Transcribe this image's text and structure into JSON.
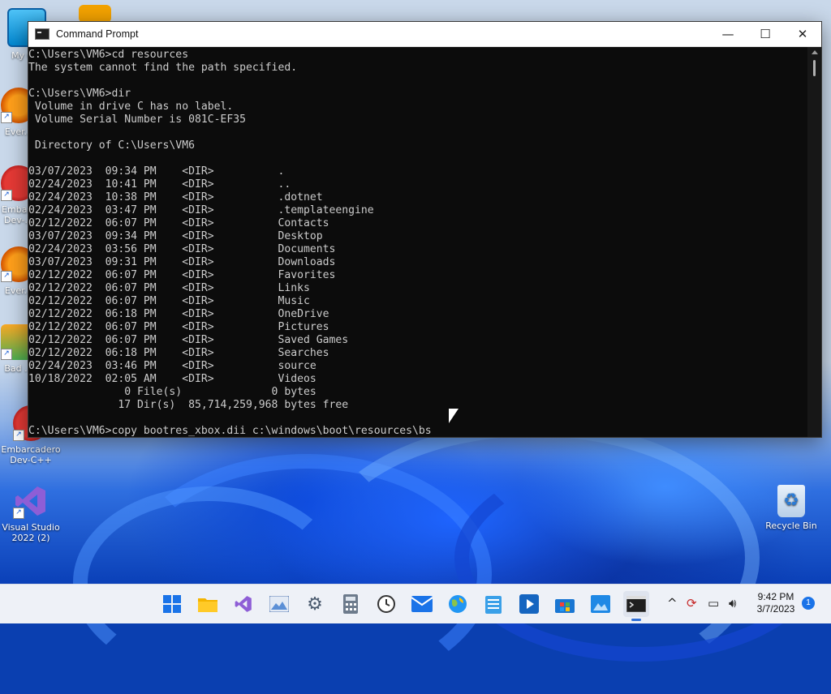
{
  "desktop": {
    "icons": [
      {
        "label": "My C...",
        "icon": "computer-icon"
      },
      {
        "label": "Ever...",
        "icon": "everything-icon"
      },
      {
        "label": "Emba... Dev-...",
        "icon": "embarcadero-icon"
      },
      {
        "label": "Ever...",
        "icon": "everything-icon"
      },
      {
        "label": "Bad ...",
        "icon": "game-icon"
      },
      {
        "label": "Embarcadero Dev-C++",
        "icon": "embarcadero-icon"
      },
      {
        "label": "Visual Studio 2022 (2)",
        "icon": "visual-studio-icon"
      },
      {
        "label": "Recycle Bin",
        "icon": "recycle-bin-icon"
      }
    ]
  },
  "window": {
    "title": "Command Prompt",
    "controls": {
      "minimize": "—",
      "maximize": "☐",
      "close": "✕"
    }
  },
  "console": {
    "lines": [
      "C:\\Users\\VM6>cd resources",
      "The system cannot find the path specified.",
      "",
      "C:\\Users\\VM6>dir",
      " Volume in drive C has no label.",
      " Volume Serial Number is 081C-EF35",
      "",
      " Directory of C:\\Users\\VM6",
      "",
      "03/07/2023  09:34 PM    <DIR>          .",
      "02/24/2023  10:41 PM    <DIR>          ..",
      "02/24/2023  10:38 PM    <DIR>          .dotnet",
      "02/24/2023  03:47 PM    <DIR>          .templateengine",
      "02/12/2022  06:07 PM    <DIR>          Contacts",
      "03/07/2023  09:34 PM    <DIR>          Desktop",
      "02/24/2023  03:56 PM    <DIR>          Documents",
      "03/07/2023  09:31 PM    <DIR>          Downloads",
      "02/12/2022  06:07 PM    <DIR>          Favorites",
      "02/12/2022  06:07 PM    <DIR>          Links",
      "02/12/2022  06:07 PM    <DIR>          Music",
      "02/12/2022  06:18 PM    <DIR>          OneDrive",
      "02/12/2022  06:07 PM    <DIR>          Pictures",
      "02/12/2022  06:07 PM    <DIR>          Saved Games",
      "02/12/2022  06:18 PM    <DIR>          Searches",
      "02/24/2023  03:46 PM    <DIR>          source",
      "10/18/2022  02:05 AM    <DIR>          Videos",
      "               0 File(s)              0 bytes",
      "              17 Dir(s)  85,714,259,968 bytes free",
      "",
      "C:\\Users\\VM6>copy bootres_xbox.dii c:\\windows\\boot\\resources\\bs"
    ]
  },
  "taskbar": {
    "items": [
      {
        "name": "start",
        "icon": "windows-start-icon"
      },
      {
        "name": "file-explorer",
        "icon": "folder-icon"
      },
      {
        "name": "visual-studio",
        "icon": "visual-studio-icon"
      },
      {
        "name": "photos",
        "icon": "photos-icon"
      },
      {
        "name": "settings",
        "icon": "gear-icon"
      },
      {
        "name": "calculator",
        "icon": "calculator-icon"
      },
      {
        "name": "clock",
        "icon": "clock-icon"
      },
      {
        "name": "mail",
        "icon": "mail-icon"
      },
      {
        "name": "maps",
        "icon": "globe-icon"
      },
      {
        "name": "notepad",
        "icon": "notepad-icon"
      },
      {
        "name": "media-player",
        "icon": "media-player-icon"
      },
      {
        "name": "store",
        "icon": "store-icon"
      },
      {
        "name": "photo-viewer",
        "icon": "image-icon"
      },
      {
        "name": "command-prompt",
        "icon": "terminal-icon",
        "active": true
      }
    ],
    "tray": {
      "time": "9:42 PM",
      "date": "3/7/2023",
      "notification_count": "1"
    }
  },
  "colors": {
    "console_bg": "#0c0c0c",
    "console_text": "#cccccc",
    "accent": "#2f6fd6"
  }
}
